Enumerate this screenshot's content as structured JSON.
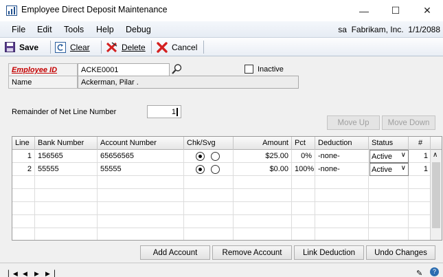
{
  "window": {
    "title": "Employee Direct Deposit Maintenance",
    "minimize": "—",
    "maximize": "☐",
    "close": "✕"
  },
  "menu": {
    "items": [
      "File",
      "Edit",
      "Tools",
      "Help",
      "Debug"
    ],
    "user": "sa",
    "company": "Fabrikam, Inc.",
    "date": "1/1/2088"
  },
  "toolbar": {
    "save": "Save",
    "clear": "Clear",
    "delete": "Delete",
    "cancel": "Cancel"
  },
  "form": {
    "employee_id_label": "Employee ID",
    "employee_id_value": "ACKE0001",
    "inactive_label": "Inactive",
    "inactive_checked": false,
    "name_label": "Name",
    "name_value": "Ackerman, Pilar  .",
    "remainder_label": "Remainder of Net Line Number",
    "remainder_value": "1",
    "move_up": "Move Up",
    "move_down": "Move Down"
  },
  "grid": {
    "headers": [
      "Line",
      "Bank Number",
      "Account Number",
      "Chk/Svg",
      "Amount",
      "Pct",
      "Deduction",
      "Status",
      "#"
    ],
    "rows": [
      {
        "line": "1",
        "bank": "156565",
        "account": "65656565",
        "checking": true,
        "amount": "$25.00",
        "pct": "0%",
        "deduction": "-none-",
        "status": "Active",
        "num": "1"
      },
      {
        "line": "2",
        "bank": "55555",
        "account": "55555",
        "checking": true,
        "amount": "$0.00",
        "pct": "100%",
        "deduction": "-none-",
        "status": "Active",
        "num": "1"
      }
    ]
  },
  "buttons": {
    "add_account": "Add Account",
    "remove_account": "Remove Account",
    "link_deduction": "Link Deduction",
    "undo_changes": "Undo Changes"
  },
  "icons": {
    "app": "chart-icon",
    "save": "floppy-disk-icon",
    "clear": "clear-icon",
    "delete": "delete-icon",
    "cancel": "cancel-icon",
    "lookup": "magnifier-icon"
  }
}
